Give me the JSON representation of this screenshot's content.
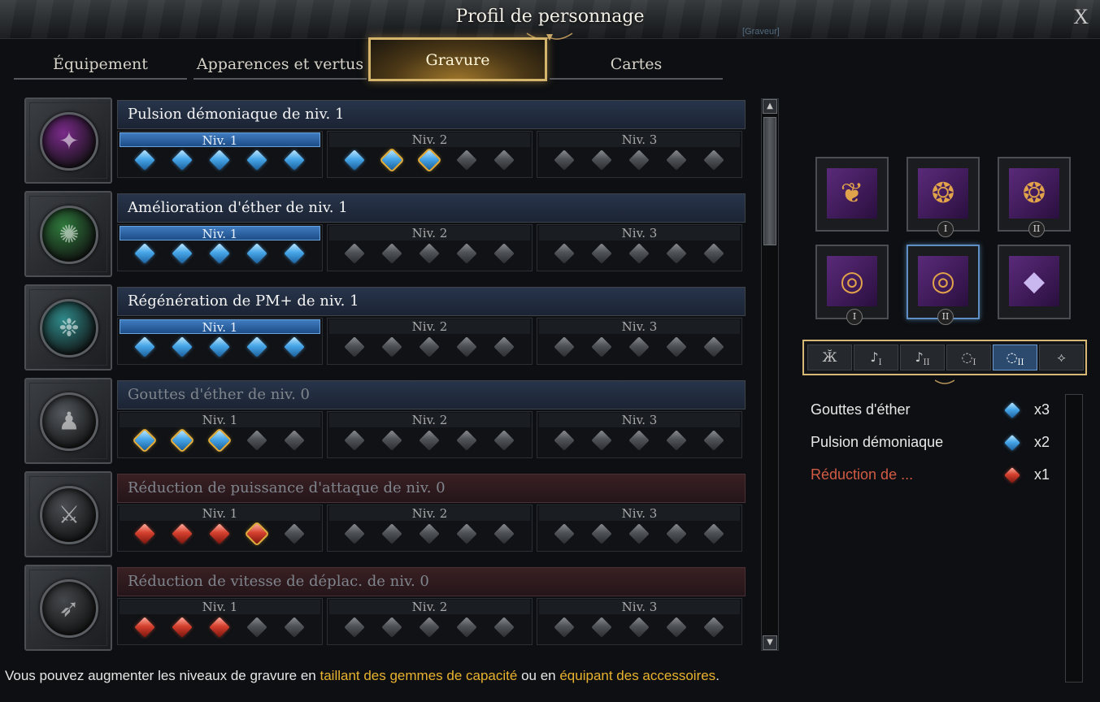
{
  "window": {
    "title": "Profil de personnage",
    "close_label": "X",
    "watermark": "[Graveur]"
  },
  "tabs": [
    {
      "label": "Équipement",
      "active": false
    },
    {
      "label": "Apparences et vertus",
      "active": false
    },
    {
      "label": "Gravure",
      "active": true
    },
    {
      "label": "Cartes",
      "active": false
    }
  ],
  "level_labels": [
    "Niv. 1",
    "Niv. 2",
    "Niv. 3"
  ],
  "engravings": [
    {
      "name": "Pulsion démoniaque de niv. 1",
      "icon": "demon-icon",
      "orb_color": "#7a2a8a",
      "dim": false,
      "negative": false,
      "levels_active": [
        true,
        false,
        false
      ],
      "gems": [
        [
          "blue",
          "blue",
          "blue",
          "blue",
          "blue"
        ],
        [
          "blue",
          "blue-gold",
          "blue-gold",
          "gray",
          "gray"
        ],
        [
          "gray",
          "gray",
          "gray",
          "gray",
          "gray"
        ]
      ]
    },
    {
      "name": "Amélioration d'éther de niv. 1",
      "icon": "ether-icon",
      "orb_color": "#2f7a3c",
      "dim": false,
      "negative": false,
      "levels_active": [
        true,
        false,
        false
      ],
      "gems": [
        [
          "blue",
          "blue",
          "blue",
          "blue",
          "blue"
        ],
        [
          "gray",
          "gray",
          "gray",
          "gray",
          "gray"
        ],
        [
          "gray",
          "gray",
          "gray",
          "gray",
          "gray"
        ]
      ]
    },
    {
      "name": "Régénération de PM+ de niv. 1",
      "icon": "mana-icon",
      "orb_color": "#2f8a8a",
      "dim": false,
      "negative": false,
      "levels_active": [
        true,
        false,
        false
      ],
      "gems": [
        [
          "blue",
          "blue",
          "blue",
          "blue",
          "blue"
        ],
        [
          "gray",
          "gray",
          "gray",
          "gray",
          "gray"
        ],
        [
          "gray",
          "gray",
          "gray",
          "gray",
          "gray"
        ]
      ]
    },
    {
      "name": "Gouttes d'éther de niv. 0",
      "icon": "drops-icon",
      "orb_color": "#555a60",
      "dim": true,
      "negative": false,
      "levels_active": [
        false,
        false,
        false
      ],
      "gems": [
        [
          "blue-gold",
          "blue-gold",
          "blue-gold",
          "gray",
          "gray"
        ],
        [
          "gray",
          "gray",
          "gray",
          "gray",
          "gray"
        ],
        [
          "gray",
          "gray",
          "gray",
          "gray",
          "gray"
        ]
      ]
    },
    {
      "name": "Réduction de puissance d'attaque de niv. 0",
      "icon": "attack-down-icon",
      "orb_color": "#4a4d52",
      "dim": true,
      "negative": true,
      "levels_active": [
        false,
        false,
        false
      ],
      "gems": [
        [
          "red",
          "red",
          "red",
          "red-gold",
          "gray"
        ],
        [
          "gray",
          "gray",
          "gray",
          "gray",
          "gray"
        ],
        [
          "gray",
          "gray",
          "gray",
          "gray",
          "gray"
        ]
      ]
    },
    {
      "name": "Réduction de vitesse de déplac. de niv. 0",
      "icon": "speed-down-icon",
      "orb_color": "#45484c",
      "dim": true,
      "negative": true,
      "levels_active": [
        false,
        false,
        false
      ],
      "gems": [
        [
          "red",
          "red",
          "red",
          "gray",
          "gray"
        ],
        [
          "gray",
          "gray",
          "gray",
          "gray",
          "gray"
        ],
        [
          "gray",
          "gray",
          "gray",
          "gray",
          "gray"
        ]
      ]
    }
  ],
  "accessories": [
    {
      "name": "necklace-icon",
      "glyph": "❦",
      "badge": "",
      "selected": false
    },
    {
      "name": "earring-1-icon",
      "glyph": "❂",
      "badge": "I",
      "selected": false
    },
    {
      "name": "earring-2-icon",
      "glyph": "❂",
      "badge": "II",
      "selected": false
    },
    {
      "name": "ring-1-icon",
      "glyph": "◎",
      "badge": "I",
      "selected": false
    },
    {
      "name": "ring-2-icon",
      "glyph": "◎",
      "badge": "II",
      "selected": true
    },
    {
      "name": "ability-stone-icon",
      "glyph": "◆",
      "badge": "",
      "selected": false
    }
  ],
  "filters": [
    {
      "name": "necklace-filter-icon",
      "glyph": "Ӂ",
      "sub": "",
      "active": false
    },
    {
      "name": "earring-1-filter-icon",
      "glyph": "♪",
      "sub": "I",
      "active": false
    },
    {
      "name": "earring-2-filter-icon",
      "glyph": "♪",
      "sub": "II",
      "active": false
    },
    {
      "name": "ring-1-filter-icon",
      "glyph": "◌",
      "sub": "I",
      "active": false
    },
    {
      "name": "ring-2-filter-icon",
      "glyph": "◌",
      "sub": "II",
      "active": true
    },
    {
      "name": "stone-filter-icon",
      "glyph": "⟡",
      "sub": "",
      "active": false
    }
  ],
  "summary": [
    {
      "name": "Gouttes d'éther",
      "gem": "blue",
      "count": "x3",
      "negative": false
    },
    {
      "name": "Pulsion démoniaque",
      "gem": "blue",
      "count": "x2",
      "negative": false
    },
    {
      "name": "Réduction de ...",
      "gem": "red",
      "count": "x1",
      "negative": true
    }
  ],
  "footer": {
    "part1": "Vous pouvez augmenter les niveaux de gravure en ",
    "link1": "taillant des gemmes de capacité",
    "part2": " ou en ",
    "link2": "équipant des accessoires",
    "part3": "."
  },
  "colors": {
    "accent_gold": "#d5b46c",
    "gem_blue": "#47a6e8",
    "gem_red": "#d5402e",
    "negative_text": "#d25b45",
    "footer_highlight": "#e9b22f"
  }
}
